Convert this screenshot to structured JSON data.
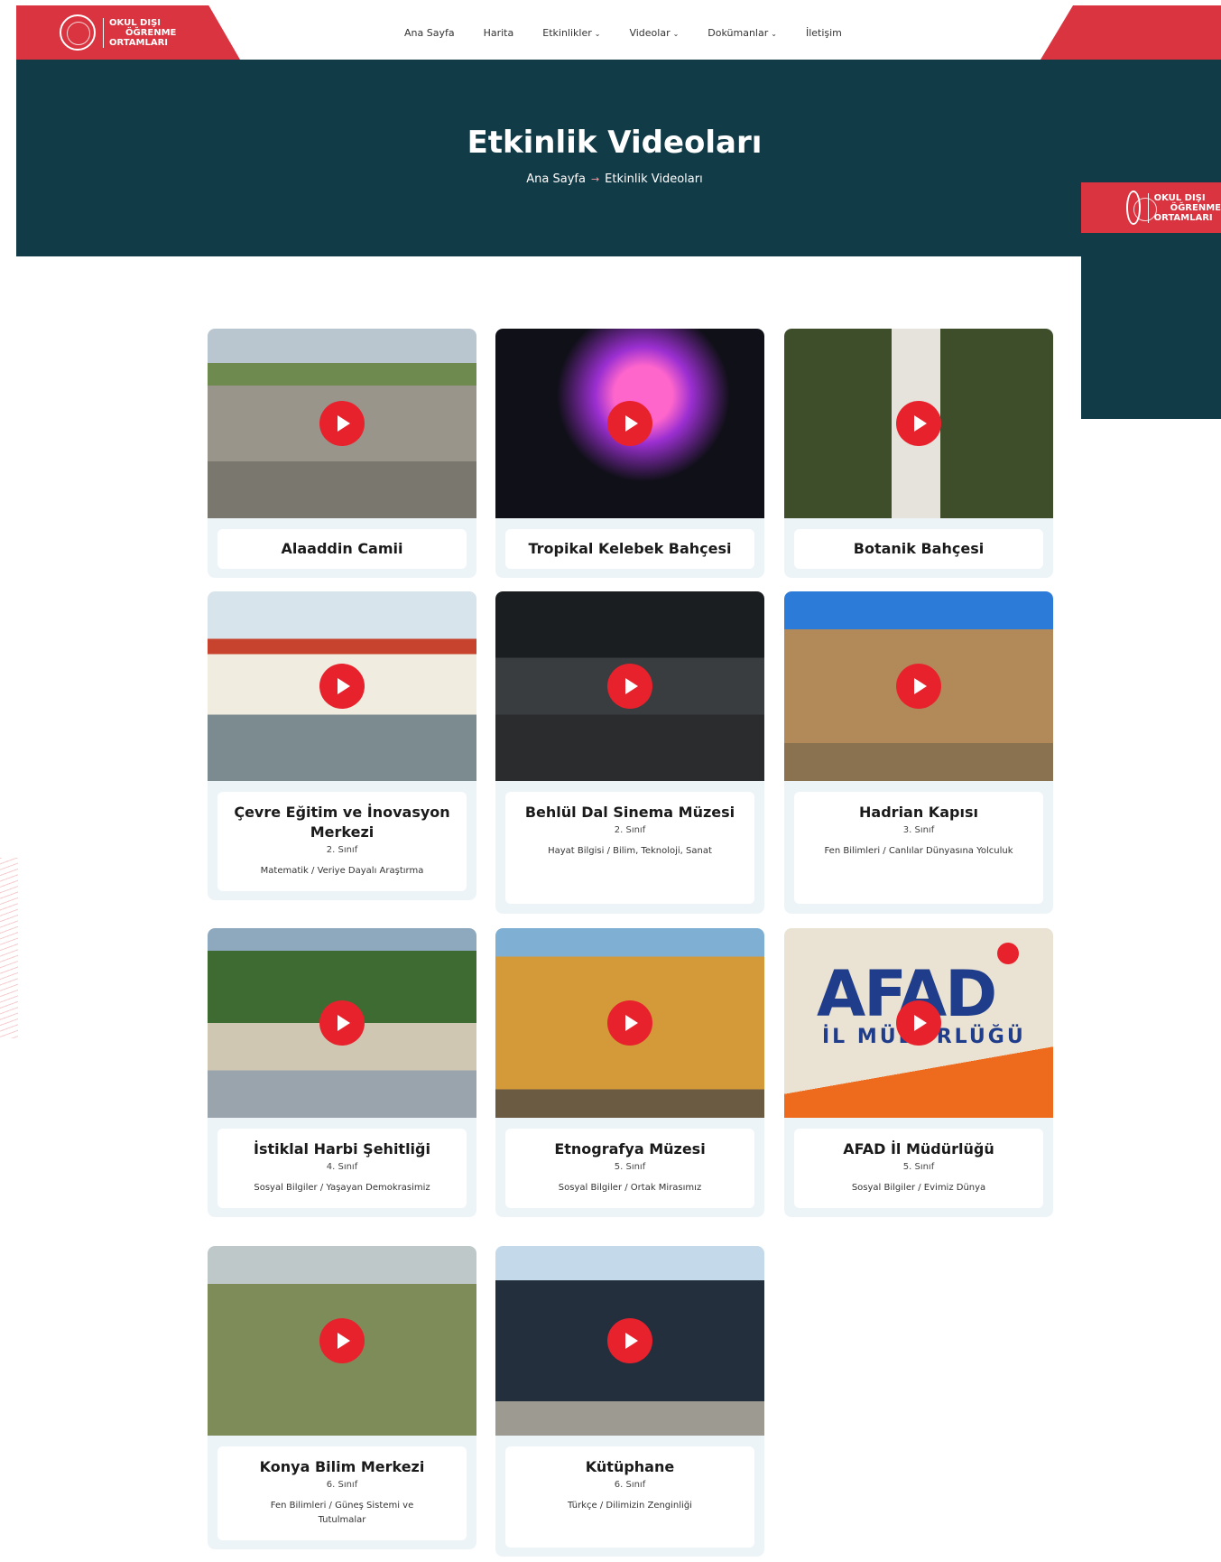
{
  "logo": {
    "line1": "OKUL DIŞI",
    "line2": "ÖĞRENME",
    "line3": "ORTAMLARI"
  },
  "nav": [
    {
      "label": "Ana Sayfa",
      "dropdown": false
    },
    {
      "label": "Harita",
      "dropdown": false
    },
    {
      "label": "Etkinlikler",
      "dropdown": true
    },
    {
      "label": "Videolar",
      "dropdown": true
    },
    {
      "label": "Dokümanlar",
      "dropdown": true
    },
    {
      "label": "İletişim",
      "dropdown": false
    }
  ],
  "hero": {
    "title": "Etkinlik Videoları",
    "breadcrumb": {
      "home": "Ana Sayfa",
      "current": "Etkinlik Videoları"
    }
  },
  "side_logo": {
    "line1": "OKUL DIŞI",
    "line2": "ÖĞRENME",
    "line3": "ORTAMLARI"
  },
  "afad_thumb": {
    "brand": "AFAD",
    "sub": "İL MÜDÜRLÜĞÜ"
  },
  "videos": [
    {
      "title": "Alaaddin Camii",
      "grade": "",
      "subject": ""
    },
    {
      "title": "Tropikal Kelebek Bahçesi",
      "grade": "",
      "subject": ""
    },
    {
      "title": "Botanik Bahçesi",
      "grade": "",
      "subject": ""
    },
    {
      "title": "Çevre Eğitim ve İnovasyon Merkezi",
      "grade": "2. Sınıf",
      "subject": "Matematik / Veriye Dayalı Araştırma"
    },
    {
      "title": "Behlül Dal Sinema Müzesi",
      "grade": "2. Sınıf",
      "subject": "Hayat Bilgisi / Bilim, Teknoloji, Sanat"
    },
    {
      "title": "Hadrian Kapısı",
      "grade": "3. Sınıf",
      "subject": "Fen Bilimleri / Canlılar Dünyasına Yolculuk"
    },
    {
      "title": "İstiklal Harbi Şehitliği",
      "grade": "4. Sınıf",
      "subject": "Sosyal Bilgiler / Yaşayan Demokrasimiz"
    },
    {
      "title": "Etnografya Müzesi",
      "grade": "5. Sınıf",
      "subject": "Sosyal Bilgiler / Ortak Mirasımız"
    },
    {
      "title": "AFAD İl Müdürlüğü",
      "grade": "5. Sınıf",
      "subject": "Sosyal Bilgiler / Evimiz Dünya"
    },
    {
      "title": "Konya Bilim Merkezi",
      "grade": "6. Sınıf",
      "subject": "Fen Bilimleri / Güneş Sistemi ve Tutulmalar"
    },
    {
      "title": "Kütüphane",
      "grade": "6. Sınıf",
      "subject": "Türkçe / Dilimizin Zenginliği"
    }
  ],
  "colors": {
    "brand_red": "#d9343f",
    "hero_bg": "#123b48",
    "play_red": "#e8222c",
    "card_bg": "#edf4f7"
  }
}
